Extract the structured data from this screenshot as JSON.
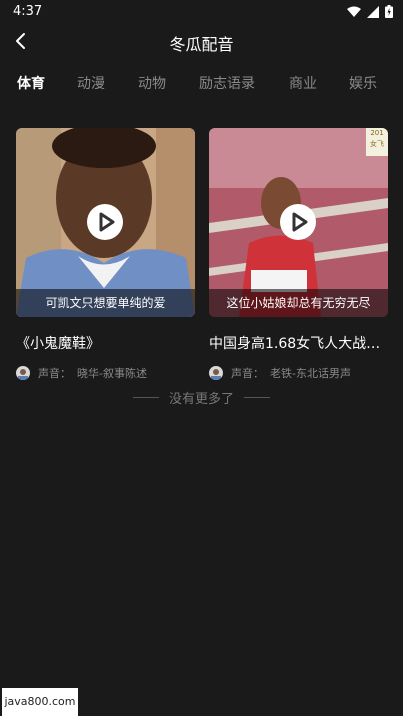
{
  "status_bar": {
    "time": "4:37"
  },
  "header": {
    "title": "冬瓜配音"
  },
  "tabs": [
    {
      "label": "体育",
      "active": true
    },
    {
      "label": "动漫",
      "active": false
    },
    {
      "label": "动物",
      "active": false
    },
    {
      "label": "励志语录",
      "active": false
    },
    {
      "label": "商业",
      "active": false
    },
    {
      "label": "娱乐",
      "active": false
    }
  ],
  "cards": [
    {
      "caption": "可凯文只想要单纯的爱",
      "title": "《小鬼魔鞋》",
      "voice_prefix": "声音：",
      "voice_name": "晓华-叙事陈述"
    },
    {
      "caption": "这位小姑娘却总有无穷无尽",
      "title": "中国身高1.68女飞人大战…",
      "voice_prefix": "声音：",
      "voice_name": "老铁-东北话男声",
      "corner_badge": "201 女飞"
    }
  ],
  "list_end_text": "没有更多了",
  "watermark": "java800.com",
  "colors": {
    "background": "#1a1a1a",
    "accent": "#ffffff",
    "muted": "#8a8a8a"
  }
}
